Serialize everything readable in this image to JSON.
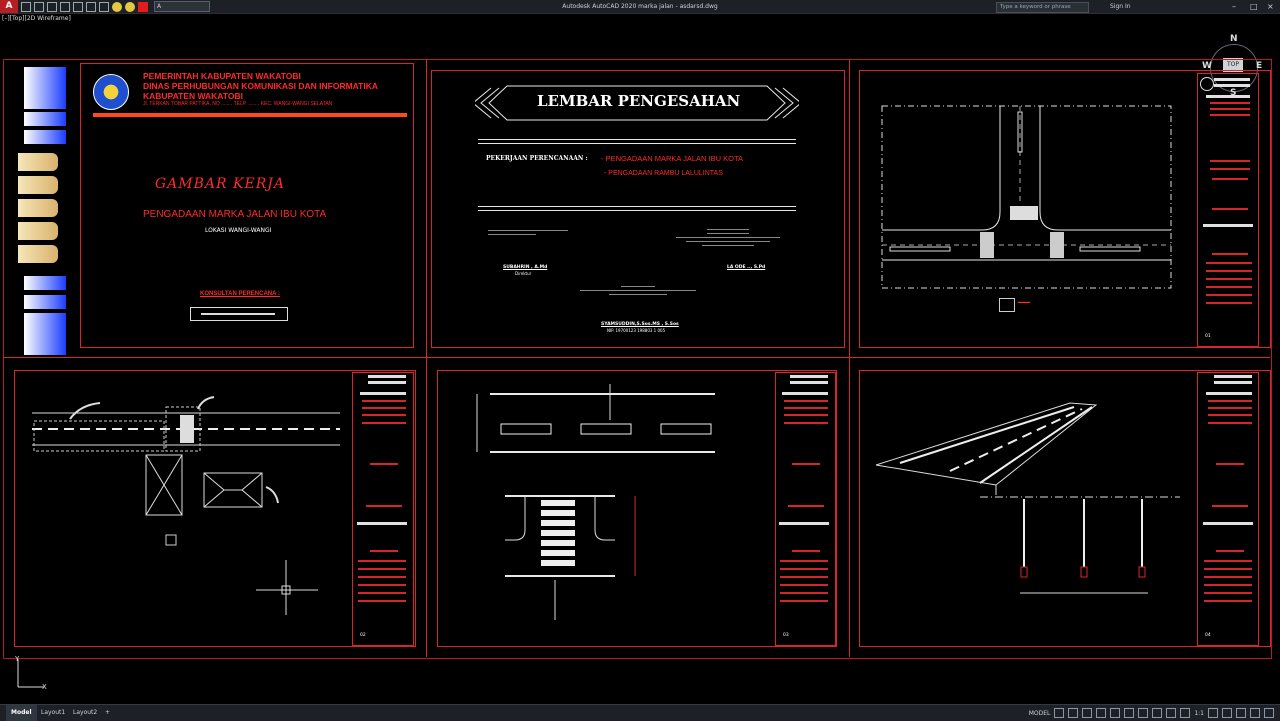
{
  "window": {
    "title": "Autodesk AutoCAD 2020    marka jalan - asdarsd.dwg",
    "search_placeholder": "Type a keyword or phrase",
    "sign_in": "Sign In",
    "layer_current": "A"
  },
  "viewport": {
    "label": "[–][Top][2D Wireframe]"
  },
  "viewcube": {
    "north": "N",
    "south": "S",
    "west": "W",
    "east": "E",
    "face": "TOP"
  },
  "cover": {
    "line1": "PEMERINTAH KABUPATEN WAKATOBI",
    "line2": "DINAS PERHUBUNGAN KOMUNIKASI DAN INFORMATIKA",
    "line3": "KABUPATEN WAKATOBI",
    "address": "Jl. TERKAN TOBAR PATTIKA, NO ........ TELP. ........ KEC. WANGI-WANGI SELATAN",
    "gambar": "GAMBAR KERJA",
    "project": "PENGADAAN MARKA JALAN IBU KOTA",
    "location": "LOKASI WANGI-WANGI",
    "consultant": "KONSULTAN PERENCANA :"
  },
  "approval": {
    "title": "LEMBAR PENGESAHAN",
    "pekerjaan_label": "PEKERJAAN  PERENCANAAN :",
    "item1": "- PENGADAAN MARKA JALAN IBU KOTA",
    "item2": "- PENGADAAN RAMBU LALULINTAS",
    "sig_left_name": "SUBAHRIN , A.Md",
    "sig_left_role": "Direktur",
    "sig_right_name": "LA ODE .., S.Pd",
    "sig_center_name": "SYAMSUDDIN,S.Sos.MS , S.Sos",
    "sig_center_nip": "NIP. 19700123 198803 1 005"
  },
  "sheets": {
    "s1_code": "01",
    "s2_code": "02",
    "s3_code": "03",
    "s4_code": "04"
  },
  "statusbar": {
    "tabs": [
      {
        "label": "Model"
      },
      {
        "label": "Layout1"
      },
      {
        "label": "Layout2"
      },
      {
        "label": "+"
      }
    ],
    "model": "MODEL",
    "scale": "1:1"
  }
}
